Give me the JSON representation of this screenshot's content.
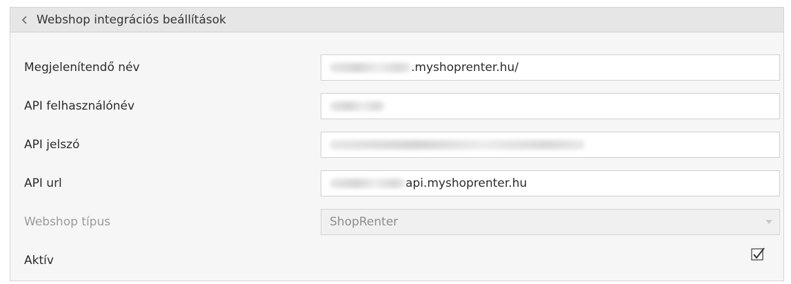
{
  "header": {
    "title": "Webshop integrációs beállítások",
    "back_icon": "chevron-left-icon"
  },
  "fields": [
    {
      "label": "Megjelenítendő név",
      "value": ".myshoprenter.hu/"
    },
    {
      "label": "API felhasználónév",
      "value": ""
    },
    {
      "label": "API jelszó",
      "value": ""
    },
    {
      "label": "API url",
      "value": "api.myshoprenter.hu"
    }
  ],
  "webshop_type": {
    "label": "Webshop típus",
    "value": "ShopRenter"
  },
  "active": {
    "label": "Aktív",
    "checked": true
  }
}
